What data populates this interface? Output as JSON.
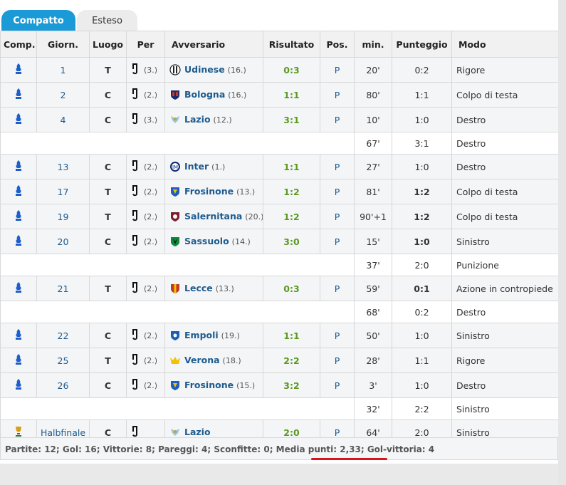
{
  "tabs": {
    "compact": "Compatto",
    "extended": "Esteso"
  },
  "headers": [
    "Comp.",
    "Giorn.",
    "Luogo",
    "Per",
    "Avversario",
    "Risultato",
    "Pos.",
    "min.",
    "Punteggio",
    "Modo"
  ],
  "rows": [
    {
      "type": "main",
      "comp": "seriea",
      "giornata": "1",
      "luogo": "T",
      "per": "(3.)",
      "opp": "Udinese",
      "opp_rank": "(16.)",
      "crest": "udinese",
      "risultato": "0:3",
      "pos": "P",
      "min": "20'",
      "punteggio": "0:2",
      "punt_bold": false,
      "modo": "Rigore"
    },
    {
      "type": "main",
      "comp": "seriea",
      "giornata": "2",
      "luogo": "C",
      "per": "(2.)",
      "opp": "Bologna",
      "opp_rank": "(16.)",
      "crest": "bologna",
      "risultato": "1:1",
      "pos": "P",
      "min": "80'",
      "punteggio": "1:1",
      "punt_bold": false,
      "modo": "Colpo di testa"
    },
    {
      "type": "main",
      "comp": "seriea",
      "giornata": "4",
      "luogo": "C",
      "per": "(3.)",
      "opp": "Lazio",
      "opp_rank": "(12.)",
      "crest": "lazio",
      "risultato": "3:1",
      "pos": "P",
      "min": "10'",
      "punteggio": "1:0",
      "punt_bold": false,
      "modo": "Destro"
    },
    {
      "type": "sub",
      "min": "67'",
      "punteggio": "3:1",
      "modo": "Destro"
    },
    {
      "type": "main",
      "comp": "seriea",
      "giornata": "13",
      "luogo": "C",
      "per": "(2.)",
      "opp": "Inter",
      "opp_rank": "(1.)",
      "crest": "inter",
      "risultato": "1:1",
      "pos": "P",
      "min": "27'",
      "punteggio": "1:0",
      "punt_bold": false,
      "modo": "Destro"
    },
    {
      "type": "main",
      "comp": "seriea",
      "giornata": "17",
      "luogo": "T",
      "per": "(2.)",
      "opp": "Frosinone",
      "opp_rank": "(13.)",
      "crest": "frosinone",
      "risultato": "1:2",
      "pos": "P",
      "min": "81'",
      "punteggio": "1:2",
      "punt_bold": true,
      "modo": "Colpo di testa"
    },
    {
      "type": "main",
      "comp": "seriea",
      "giornata": "19",
      "luogo": "T",
      "per": "(2.)",
      "opp": "Salernitana",
      "opp_rank": "(20.)",
      "crest": "salernitana",
      "risultato": "1:2",
      "pos": "P",
      "min": "90'+1",
      "punteggio": "1:2",
      "punt_bold": true,
      "modo": "Colpo di testa"
    },
    {
      "type": "main",
      "comp": "seriea",
      "giornata": "20",
      "luogo": "C",
      "per": "(2.)",
      "opp": "Sassuolo",
      "opp_rank": "(14.)",
      "crest": "sassuolo",
      "risultato": "3:0",
      "pos": "P",
      "min": "15'",
      "punteggio": "1:0",
      "punt_bold": true,
      "modo": "Sinistro"
    },
    {
      "type": "sub",
      "min": "37'",
      "punteggio": "2:0",
      "modo": "Punizione"
    },
    {
      "type": "main",
      "comp": "seriea",
      "giornata": "21",
      "luogo": "T",
      "per": "(2.)",
      "opp": "Lecce",
      "opp_rank": "(13.)",
      "crest": "lecce",
      "risultato": "0:3",
      "pos": "P",
      "min": "59'",
      "punteggio": "0:1",
      "punt_bold": true,
      "modo": "Azione in contropiede"
    },
    {
      "type": "sub",
      "min": "68'",
      "punteggio": "0:2",
      "modo": "Destro"
    },
    {
      "type": "main",
      "comp": "seriea",
      "giornata": "22",
      "luogo": "C",
      "per": "(2.)",
      "opp": "Empoli",
      "opp_rank": "(19.)",
      "crest": "empoli",
      "risultato": "1:1",
      "pos": "P",
      "min": "50'",
      "punteggio": "1:0",
      "punt_bold": false,
      "modo": "Sinistro"
    },
    {
      "type": "main",
      "comp": "seriea",
      "giornata": "25",
      "luogo": "T",
      "per": "(2.)",
      "opp": "Verona",
      "opp_rank": "(18.)",
      "crest": "verona",
      "risultato": "2:2",
      "pos": "P",
      "min": "28'",
      "punteggio": "1:1",
      "punt_bold": false,
      "modo": "Rigore"
    },
    {
      "type": "main",
      "comp": "seriea",
      "giornata": "26",
      "luogo": "C",
      "per": "(2.)",
      "opp": "Frosinone",
      "opp_rank": "(15.)",
      "crest": "frosinone",
      "risultato": "3:2",
      "pos": "P",
      "min": "3'",
      "punteggio": "1:0",
      "punt_bold": false,
      "modo": "Destro"
    },
    {
      "type": "sub",
      "min": "32'",
      "punteggio": "2:2",
      "modo": "Sinistro"
    },
    {
      "type": "main",
      "comp": "coppa",
      "giornata": "Halbfinale",
      "luogo": "C",
      "per": "",
      "opp": "Lazio",
      "opp_rank": "",
      "crest": "lazio",
      "risultato": "2:0",
      "pos": "P",
      "min": "64'",
      "punteggio": "2:0",
      "punt_bold": false,
      "modo": "Sinistro"
    }
  ],
  "footer": "Partite: 12; Gol: 16; Vittorie: 8; Pareggi: 4; Sconfitte: 0; Media punti: 2,33; Gol-vittoria: 4",
  "colors": {
    "accent": "#1a9ad6",
    "link": "#1d5b8e",
    "result_green": "#5b9a22",
    "underline_red": "#d6131f"
  }
}
